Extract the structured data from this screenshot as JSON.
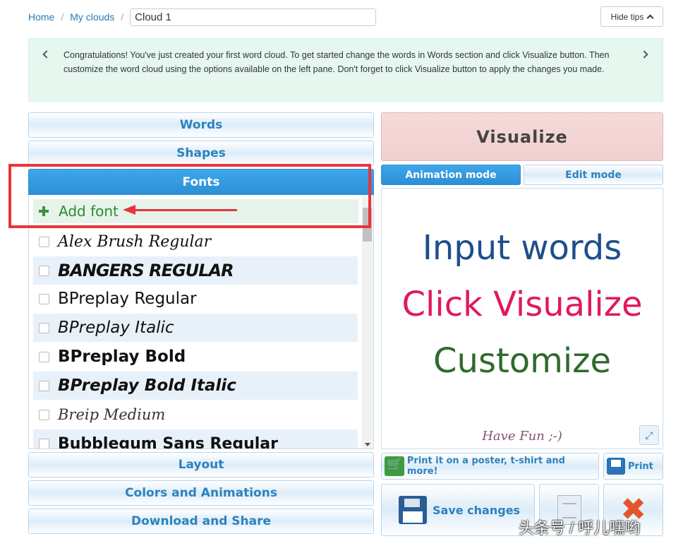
{
  "breadcrumb": {
    "home": "Home",
    "my_clouds": "My clouds",
    "sep": "/",
    "cloud_name": "Cloud 1"
  },
  "hide_tips": "Hide tips",
  "tip": "Congratulations! You've just created your first word cloud. To get started change the words in Words section and click Visualize button. Then customize the word cloud using the options available on the left pane. Don't forget to click Visualize button to apply the changes you made.",
  "left": {
    "sections": {
      "words": "Words",
      "shapes": "Shapes",
      "fonts": "Fonts",
      "layout": "Layout",
      "colors": "Colors and Animations",
      "download": "Download and Share"
    },
    "add_font": "Add font",
    "fonts": [
      "Alex Brush Regular",
      "BANGERS REGULAR",
      "BPreplay Regular",
      "BPreplay Italic",
      "BPreplay Bold",
      "BPreplay Bold Italic",
      "Breip Medium",
      "Bubblegum Sans Regular"
    ]
  },
  "right": {
    "visualize": "Visualize",
    "animation_mode": "Animation mode",
    "edit_mode": "Edit mode",
    "canvas_words": [
      "Input words",
      "Click Visualize",
      "Customize",
      "Have Fun ;-)"
    ],
    "print_poster": "Print it on a poster, t-shirt and more!",
    "print": "Print",
    "save_changes": "Save changes"
  },
  "watermark": "头条号 / 呼儿嘿哟",
  "colors": {
    "accent": "#2d8fd6",
    "highlight": "#e8353a",
    "visualize_bg": "#f1cfcf"
  }
}
